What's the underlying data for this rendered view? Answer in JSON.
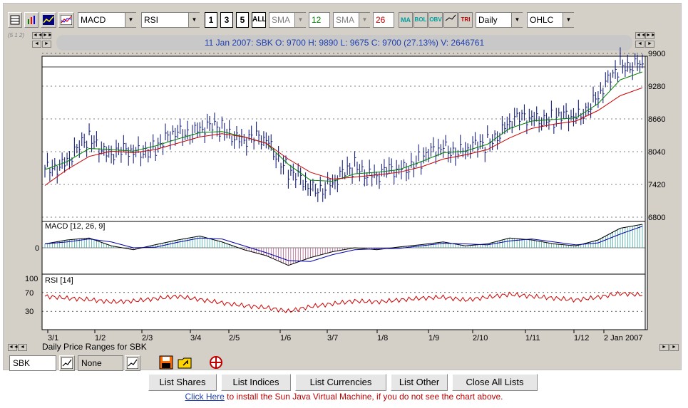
{
  "toolbar": {
    "indicator1": "MACD",
    "indicator2": "RSI",
    "periods": [
      "1",
      "3",
      "5",
      "ALL"
    ],
    "ma1_type": "SMA",
    "ma1_value": "12",
    "ma2_type": "SMA",
    "ma2_value": "26",
    "ind_buttons": [
      "MA",
      "BOL",
      "OBV",
      "",
      "TRI"
    ],
    "interval": "Daily",
    "chart_style": "OHLC"
  },
  "info_bar": {
    "text": "11 Jan 2007: SBK  O: 9700  H: 9890  L: 9675  C: 9700 (27.13%)  V: 2646761"
  },
  "zoom_label": "(5 1 2)",
  "price_panel": {
    "y_ticks": [
      "9900",
      "9280",
      "8660",
      "8040",
      "7420",
      "6800"
    ]
  },
  "macd_panel": {
    "label": "MACD [12, 26, 9]",
    "zero_label": "0"
  },
  "rsi_panel": {
    "label": "RSI [14]",
    "ticks": [
      "100",
      "70",
      "30"
    ]
  },
  "x_axis": {
    "labels": [
      "3/1",
      "1/2",
      "2/3",
      "3/4",
      "2/5",
      "1/6",
      "3/7",
      "1/8",
      "1/9",
      "2/10",
      "1/11",
      "1/12",
      "2 Jan 2007"
    ]
  },
  "caption": "Daily Price Ranges  for SBK",
  "symbol_input": "SBK",
  "compare_input": "None",
  "bottom_buttons": [
    "List Shares",
    "List Indices",
    "List Currencies",
    "List Other",
    "Close All Lists"
  ],
  "footer": {
    "link": "Click Here",
    "text": " to install the Sun Java Virtual Machine, if you do not see the chart above."
  },
  "chart_data": {
    "type": "ohlc",
    "title": "11 Jan 2007: SBK",
    "ylim": [
      6800,
      9900
    ],
    "x_labels": [
      "3/1",
      "1/2",
      "2/3",
      "3/4",
      "2/5",
      "1/6",
      "3/7",
      "1/8",
      "1/9",
      "2/10",
      "1/11",
      "1/12",
      "2 Jan 2007"
    ],
    "close_series": [
      7650,
      7900,
      8250,
      8050,
      8000,
      8150,
      8350,
      8500,
      8450,
      8300,
      8250,
      7700,
      7300,
      7450,
      7750,
      7600,
      7700,
      7900,
      8100,
      8050,
      8200,
      8600,
      8700,
      8650,
      8700,
      9050,
      9700,
      9700
    ],
    "ma_short_series": [
      7700,
      7850,
      8100,
      8080,
      8050,
      8150,
      8280,
      8400,
      8420,
      8320,
      8200,
      7800,
      7500,
      7480,
      7620,
      7650,
      7700,
      7850,
      8020,
      8050,
      8180,
      8480,
      8620,
      8650,
      8680,
      8950,
      9400,
      9550
    ],
    "ma_long_series": [
      7400,
      7700,
      7950,
      8050,
      8020,
      8080,
      8200,
      8320,
      8380,
      8320,
      8200,
      7900,
      7650,
      7520,
      7560,
      7600,
      7650,
      7750,
      7900,
      7980,
      8080,
      8300,
      8480,
      8560,
      8620,
      8820,
      9100,
      9250
    ],
    "rsi_series": [
      62,
      58,
      55,
      50,
      52,
      57,
      62,
      55,
      48,
      42,
      38,
      30,
      40,
      46,
      52,
      50,
      54,
      58,
      60,
      54,
      60,
      66,
      62,
      58,
      54,
      60,
      68,
      65
    ],
    "rsi_ticks": [
      100,
      70,
      30
    ],
    "macd_series": [
      10,
      20,
      25,
      5,
      -5,
      8,
      20,
      30,
      15,
      -5,
      -20,
      -45,
      -25,
      -10,
      0,
      -5,
      2,
      8,
      15,
      5,
      10,
      25,
      20,
      10,
      5,
      20,
      50,
      60
    ]
  }
}
